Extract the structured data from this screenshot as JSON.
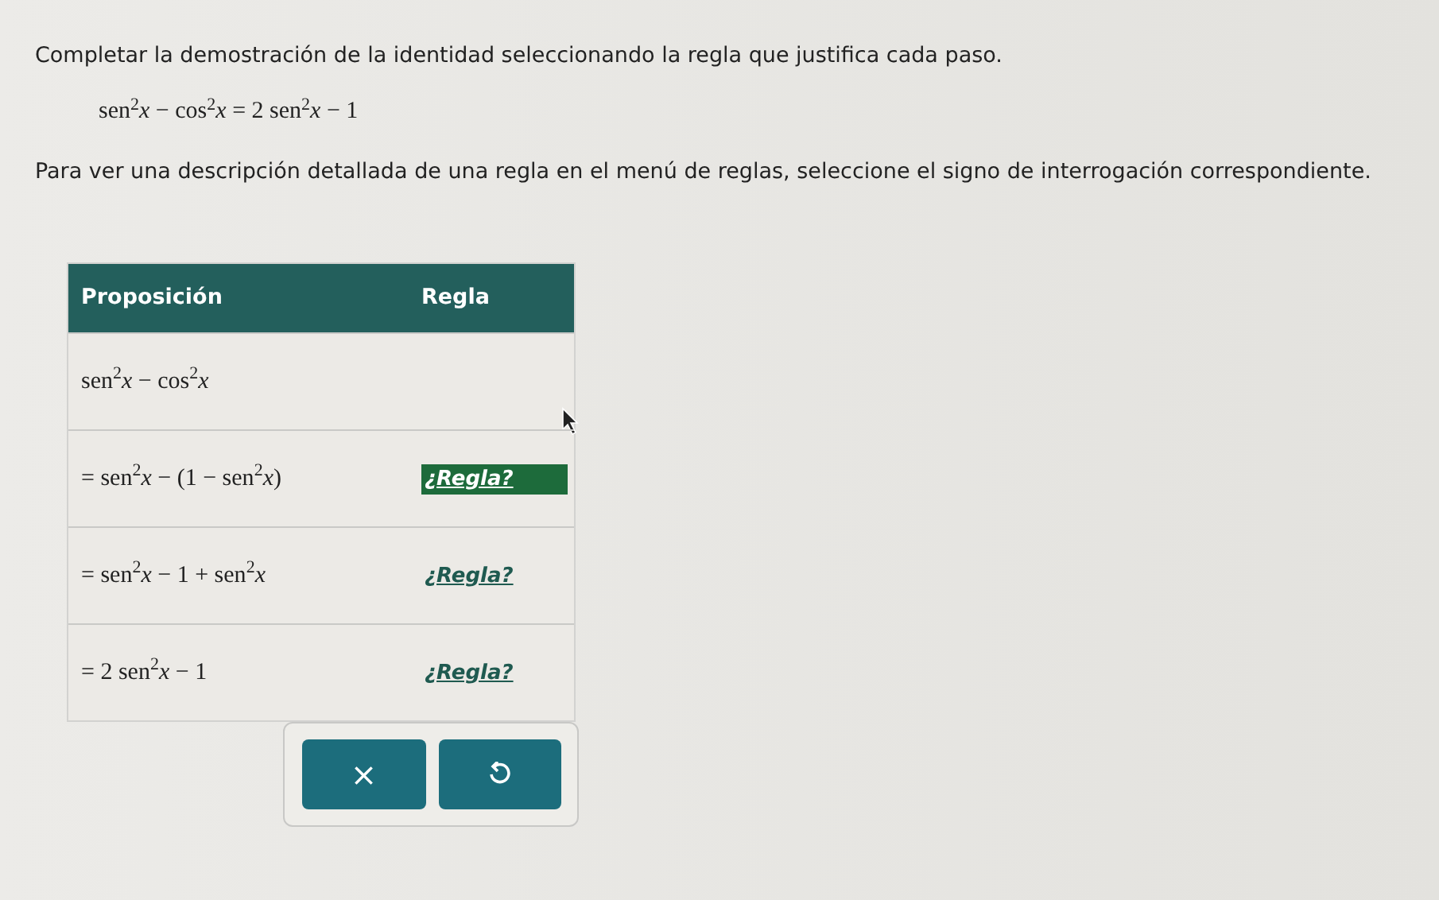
{
  "instruction": "Completar la demostración de la identidad seleccionando la regla que justifica cada paso.",
  "identity": "sen$^{2}$*x* − cos$^{2}$*x* = 2 sen$^{2}$*x* − 1",
  "help": "Para ver una descripción detallada de una regla en el menú de reglas, seleccione el signo de interrogación correspondiente.",
  "table": {
    "columns": [
      "Proposición",
      "Regla"
    ],
    "rows": [
      {
        "statement": "sen$^{2}$*x* − cos$^{2}$*x*"
      },
      {
        "statement": "= sen$^{2}$*x* − (1 − sen$^{2}$*x*)",
        "rule": "¿Regla?",
        "selected": true
      },
      {
        "statement": "= sen$^{2}$*x* − 1 + sen$^{2}$*x*",
        "rule": "¿Regla?",
        "selected": false
      },
      {
        "statement": "= 2 sen$^{2}$*x* − 1",
        "rule": "¿Regla?",
        "selected": false
      }
    ]
  },
  "buttons": [
    {
      "kind": "clear",
      "label": "×"
    },
    {
      "kind": "undo"
    }
  ]
}
